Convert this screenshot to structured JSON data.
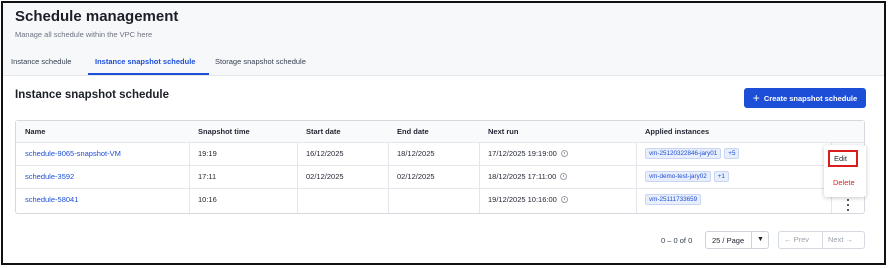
{
  "header": {
    "title": "Schedule management",
    "subtitle": "Manage all schedule within the VPC here"
  },
  "tabs": [
    {
      "label": "Instance schedule",
      "active": false
    },
    {
      "label": "Instance snapshot schedule",
      "active": true
    },
    {
      "label": "Storage snapshot schedule",
      "active": false
    }
  ],
  "section": {
    "title": "Instance snapshot schedule",
    "create_label": "Create snapshot schedule",
    "create_icon": "plus-icon"
  },
  "table": {
    "columns": [
      "Name",
      "Snapshot time",
      "Start date",
      "End date",
      "Next run",
      "Applied instances"
    ],
    "rows": [
      {
        "name": "schedule-9065-snapshot-VM",
        "snapshot_time": "19:19",
        "start_date": "16/12/2025",
        "end_date": "18/12/2025",
        "next_run": "17/12/2025 19:19:00",
        "instance": "vm-25120322846-jary01",
        "more": "+5"
      },
      {
        "name": "schedule-3592",
        "snapshot_time": "17:11",
        "start_date": "02/12/2025",
        "end_date": "02/12/2025",
        "next_run": "18/12/2025 17:11:00",
        "instance": "vm-demo-test-jary02",
        "more": "+1"
      },
      {
        "name": "schedule-58041",
        "snapshot_time": "10:16",
        "start_date": "",
        "end_date": "",
        "next_run": "19/12/2025 10:16:00",
        "instance": "vm-25111733659",
        "more": ""
      }
    ]
  },
  "row_menu": {
    "edit": "Edit",
    "delete": "Delete"
  },
  "pagination": {
    "count": "0 – 0 of 0",
    "page_size": "25 / Page",
    "prev": "Prev",
    "next": "Next"
  },
  "colors": {
    "accent": "#1d4ed8",
    "danger": "#dc2626",
    "highlight_border": "#d91c1c"
  }
}
